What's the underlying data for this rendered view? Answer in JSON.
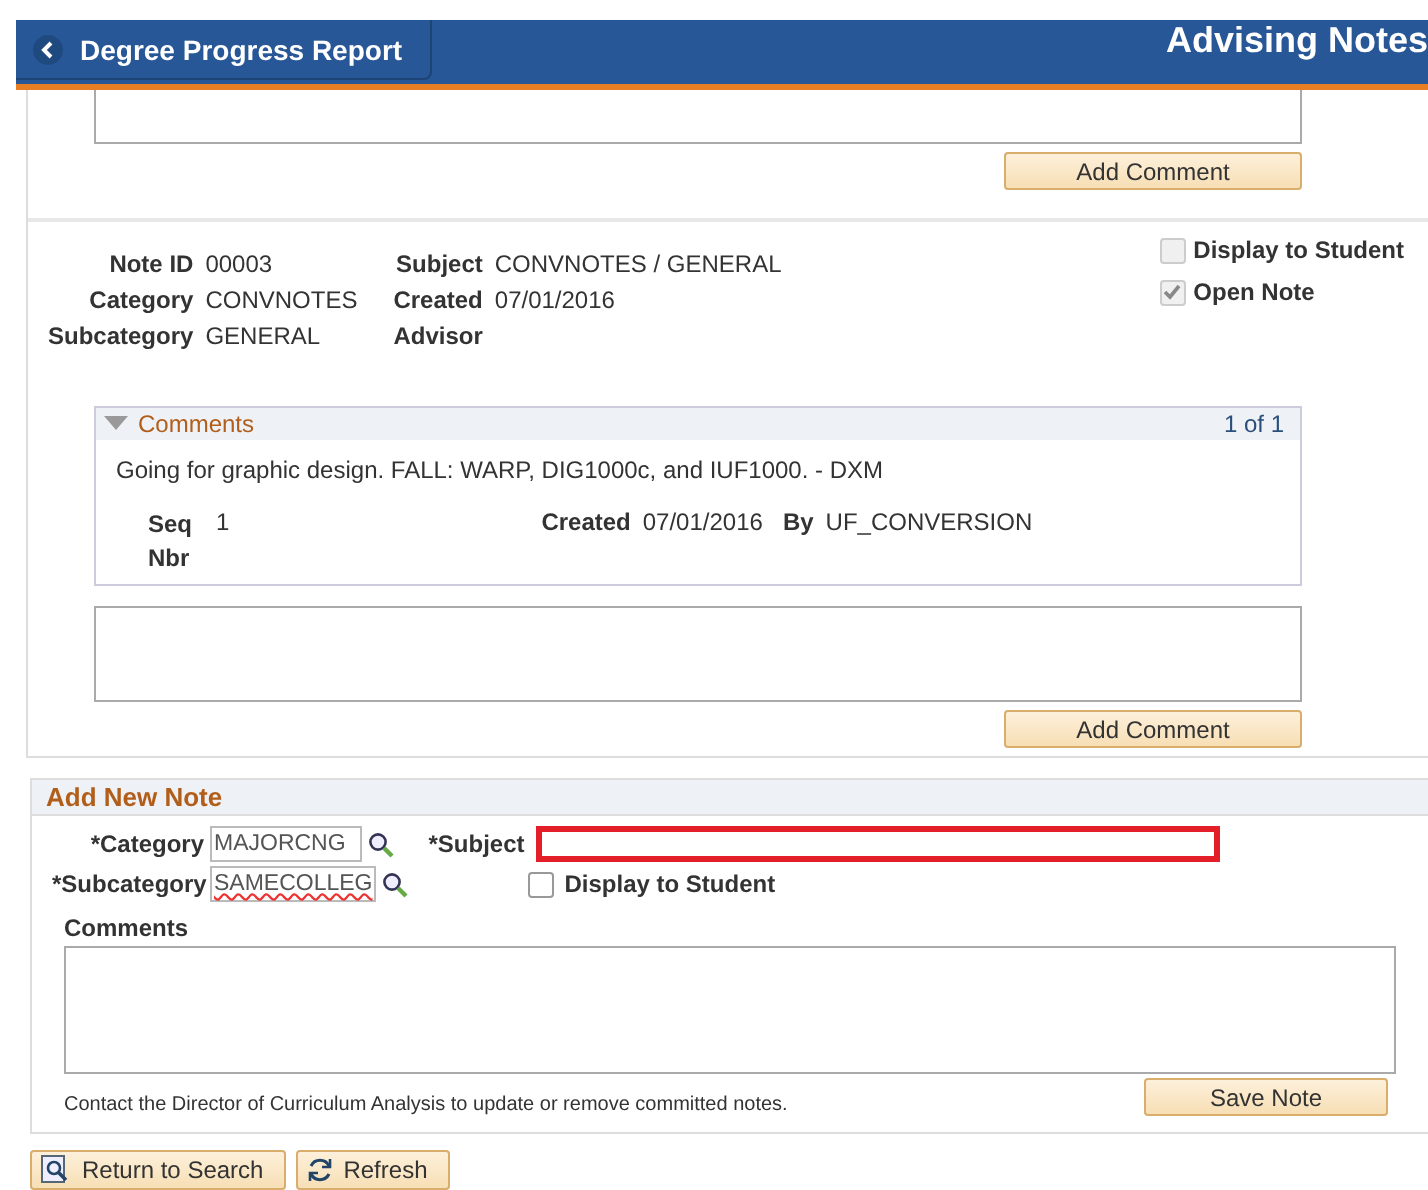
{
  "header": {
    "back_label": "Degree Progress Report",
    "title": "Advising Notes"
  },
  "top_comment": {
    "button": "Add Comment"
  },
  "note": {
    "left_fields": [
      {
        "label": "Note ID",
        "value": "00003"
      },
      {
        "label": "Category",
        "value": "CONVNOTES"
      },
      {
        "label": "Subcategory",
        "value": "GENERAL"
      }
    ],
    "right_fields": [
      {
        "label": "Subject",
        "value": "CONVNOTES / GENERAL"
      },
      {
        "label": "Created",
        "value": "07/01/2016"
      },
      {
        "label": "Advisor"
      }
    ],
    "checkboxes": [
      {
        "label": "Display to Student",
        "checked": false,
        "disabled": true
      },
      {
        "label": "Open Note",
        "checked": true,
        "disabled": true
      }
    ],
    "comments": {
      "title": "Comments",
      "expanded": true,
      "counter": "1 of 1",
      "items": [
        {
          "text": "Going for graphic design. FALL: WARP, DIG1000c, and IUF1000. - DXM",
          "seq_label": "Seq Nbr",
          "seq": "1",
          "created_label": "Created",
          "created": "07/01/2016",
          "by_label": "By",
          "by": "UF_CONVERSION"
        }
      ]
    },
    "button": "Add Comment"
  },
  "new_note": {
    "title": "Add New Note",
    "category": {
      "label": "*Category",
      "value": "MAJORCNG"
    },
    "subcategory": {
      "label": "*Subcategory",
      "value": "SAMECOLLEG",
      "misspelled": true
    },
    "subject": {
      "label": "*Subject",
      "highlighted": true
    },
    "display": {
      "label": "Display to Student",
      "checked": false
    },
    "comments_label": "Comments",
    "info": "Contact the Director of Curriculum Analysis to update or remove committed notes.",
    "button": "Save Note"
  },
  "footer_buttons": [
    {
      "kind": "search",
      "label": "Return to Search"
    },
    {
      "kind": "refresh",
      "label": "Refresh"
    }
  ]
}
